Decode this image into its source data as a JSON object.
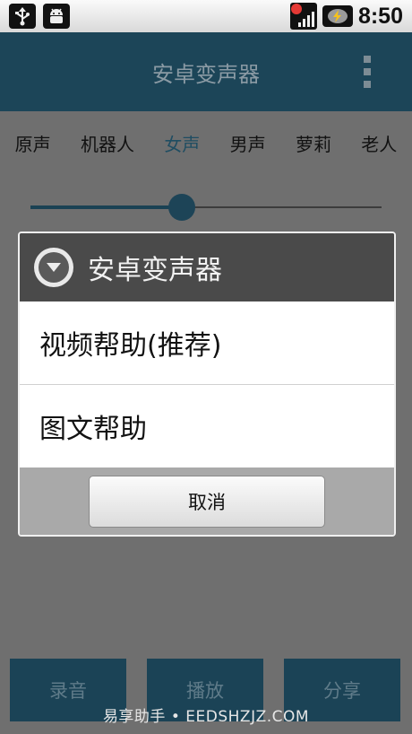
{
  "app": {
    "title": "安卓变声器"
  },
  "status_bar": {
    "time": "8:50"
  },
  "voice_tabs": [
    {
      "label": "原声"
    },
    {
      "label": "机器人"
    },
    {
      "label": "女声",
      "selected": true
    },
    {
      "label": "男声"
    },
    {
      "label": "萝莉"
    },
    {
      "label": "老人"
    }
  ],
  "slider": {
    "value_fraction": 0.43
  },
  "dialog": {
    "title": "安卓变声器",
    "items": [
      {
        "label": "视频帮助(推荐)"
      },
      {
        "label": "图文帮助"
      }
    ],
    "cancel_label": "取消"
  },
  "bottom_buttons": {
    "record_label": "录音",
    "play_label": "播放",
    "share_label": "分享"
  },
  "watermark": {
    "text": "易享助手 • EEDSHZJZ.COM"
  },
  "colors": {
    "accent": "#1c4558",
    "active_tab": "#1f4d62",
    "overlay": "#6f6f6f"
  }
}
